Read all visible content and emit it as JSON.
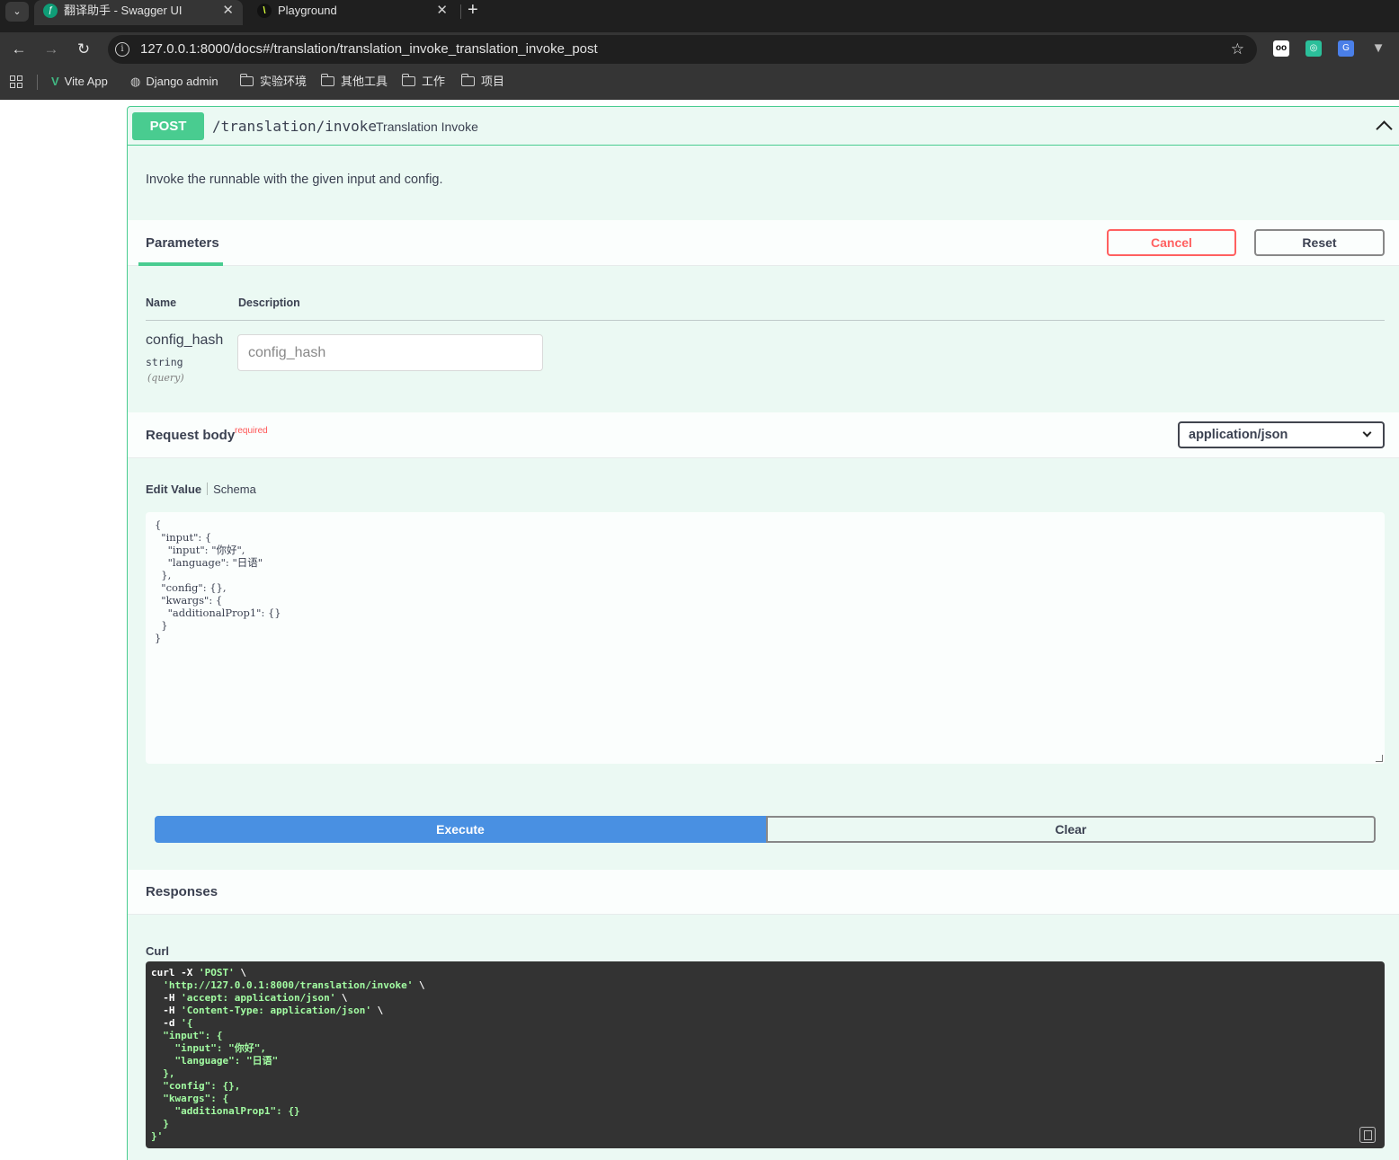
{
  "browser": {
    "tabs": [
      {
        "title": "翻译助手 - Swagger UI",
        "active": true
      },
      {
        "title": "Playground",
        "active": false
      }
    ],
    "new_tab": "+",
    "close": "✕",
    "url": "127.0.0.1:8000/docs#/translation/translation_invoke_translation_invoke_post",
    "bookmarks": [
      "Vite App",
      "Django admin",
      "实验环境",
      "其他工具",
      "工作",
      "项目"
    ]
  },
  "operation": {
    "method": "POST",
    "path": "/translation/invoke",
    "summary": "Translation Invoke",
    "description": "Invoke the runnable with the given input and config."
  },
  "parameters": {
    "title": "Parameters",
    "cancel_label": "Cancel",
    "reset_label": "Reset",
    "col_name": "Name",
    "col_description": "Description",
    "items": [
      {
        "name": "config_hash",
        "type": "string",
        "in": "(query)",
        "placeholder": "config_hash"
      }
    ]
  },
  "request_body": {
    "title": "Request body",
    "required_label": "required",
    "content_type": "application/json",
    "tab_edit": "Edit Value",
    "tab_schema": "Schema",
    "value": "{\n  \"input\": {\n    \"input\": \"你好\",\n    \"language\": \"日语\"\n  },\n  \"config\": {},\n  \"kwargs\": {\n    \"additionalProp1\": {}\n  }\n}"
  },
  "actions": {
    "execute_label": "Execute",
    "clear_label": "Clear"
  },
  "responses": {
    "title": "Responses",
    "curl_label": "Curl",
    "curl_lines": [
      {
        "cmd": "curl -X ",
        "str": "'POST'",
        "tail": " \\"
      },
      {
        "cmd": "  ",
        "str": "'http://127.0.0.1:8000/translation/invoke'",
        "tail": " \\"
      },
      {
        "cmd": "  -H ",
        "str": "'accept: application/json'",
        "tail": " \\"
      },
      {
        "cmd": "  -H ",
        "str": "'Content-Type: application/json'",
        "tail": " \\"
      },
      {
        "cmd": "  -d ",
        "str": "'{",
        "tail": ""
      },
      {
        "cmd": "",
        "str": "  \"input\": {",
        "tail": ""
      },
      {
        "cmd": "",
        "str": "    \"input\": \"你好\",",
        "tail": ""
      },
      {
        "cmd": "",
        "str": "    \"language\": \"日语\"",
        "tail": ""
      },
      {
        "cmd": "",
        "str": "  },",
        "tail": ""
      },
      {
        "cmd": "",
        "str": "  \"config\": {},",
        "tail": ""
      },
      {
        "cmd": "",
        "str": "  \"kwargs\": {",
        "tail": ""
      },
      {
        "cmd": "",
        "str": "    \"additionalProp1\": {}",
        "tail": ""
      },
      {
        "cmd": "",
        "str": "  }",
        "tail": ""
      },
      {
        "cmd": "",
        "str": "}'",
        "tail": ""
      }
    ]
  },
  "colors": {
    "post_green": "#49cc90",
    "execute_blue": "#4990e2",
    "cancel_red": "#ff6060",
    "curl_bg": "#333333",
    "curl_string": "#a2fca2"
  }
}
